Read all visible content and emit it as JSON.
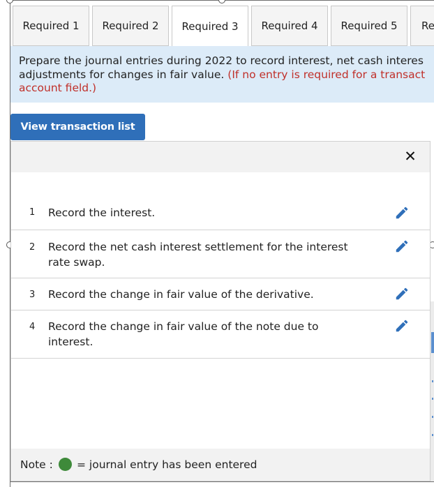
{
  "tabs": [
    {
      "label": "Required 1",
      "active": false
    },
    {
      "label": "Required 2",
      "active": false
    },
    {
      "label": "Required 3",
      "active": true
    },
    {
      "label": "Required 4",
      "active": false
    },
    {
      "label": "Required 5",
      "active": false
    },
    {
      "label": "Re",
      "active": false
    }
  ],
  "instructions": {
    "line1": "Prepare the journal entries during 2022 to record interest, net cash interes",
    "line2_black": "adjustments for changes in fair value. ",
    "line2_red": "(If no entry is required for a transact",
    "line3_red": "account field.)"
  },
  "view_button": {
    "label": "View transaction list"
  },
  "panel": {
    "close_icon": "close-icon",
    "transactions": [
      {
        "num": "1",
        "text": "Record the interest."
      },
      {
        "num": "2",
        "text": "Record the net cash interest settlement for the interest rate swap."
      },
      {
        "num": "3",
        "text": "Record the change in fair value of the derivative."
      },
      {
        "num": "4",
        "text": "Record the change in fair value of the note due to interest."
      }
    ],
    "edit_icon": "pencil-icon",
    "note": {
      "label": "Note :",
      "text": "= journal entry has been entered",
      "dot_color": "#3e8a3a"
    }
  },
  "colors": {
    "accent": "#2f6fb9",
    "instruction_bg": "#dcebf8",
    "instruction_red": "#c0302a"
  }
}
